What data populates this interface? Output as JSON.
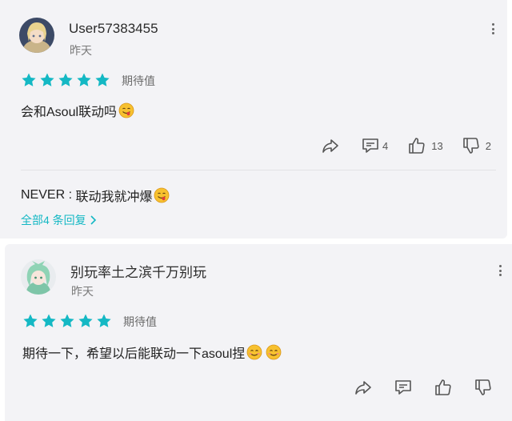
{
  "colors": {
    "card_bg": "#f3f3f6",
    "star": "#14b8c4",
    "link": "#14b8c4",
    "muted_text": "#7a7a7a"
  },
  "comments": [
    {
      "username": "User57383455",
      "time": "昨天",
      "rating": 5,
      "rating_label": "期待值",
      "text": "会和Asoul联动吗",
      "emoji": "smiling-tongue-emoji",
      "actions": {
        "reply_count": "4",
        "like_count": "13",
        "dislike_count": "2"
      },
      "reply_preview": {
        "author": "NEVER",
        "separator": " : ",
        "text": "联动我就冲爆"
      },
      "replies_link": "全部4 条回复"
    },
    {
      "username": "别玩率土之滨千万别玩",
      "time": "昨天",
      "rating": 5,
      "rating_label": "期待值",
      "text": "期待一下，希望以后能联动一下asoul捏",
      "emoji": "smiling-blush-emoji"
    }
  ],
  "icons": [
    "kebab-menu-icon",
    "star-icon",
    "share-icon",
    "comment-icon",
    "thumbs-up-icon",
    "thumbs-down-icon",
    "chevron-right-icon"
  ]
}
